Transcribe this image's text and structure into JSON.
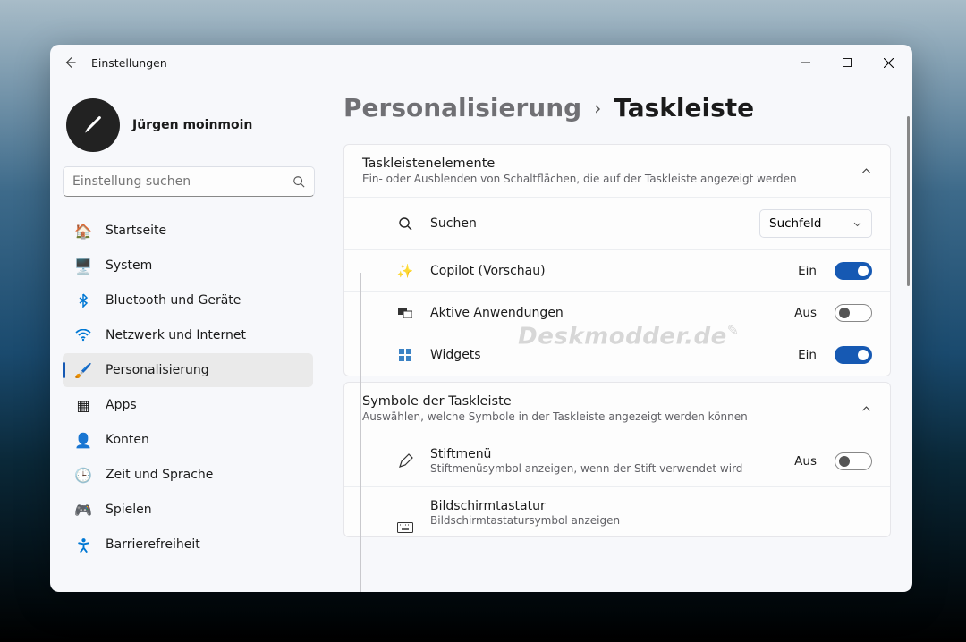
{
  "window": {
    "title": "Einstellungen"
  },
  "user": {
    "name": "Jürgen moinmoin"
  },
  "search": {
    "placeholder": "Einstellung suchen"
  },
  "nav": {
    "items": [
      {
        "label": "Startseite"
      },
      {
        "label": "System"
      },
      {
        "label": "Bluetooth und Geräte"
      },
      {
        "label": "Netzwerk und Internet"
      },
      {
        "label": "Personalisierung"
      },
      {
        "label": "Apps"
      },
      {
        "label": "Konten"
      },
      {
        "label": "Zeit und Sprache"
      },
      {
        "label": "Spielen"
      },
      {
        "label": "Barrierefreiheit"
      }
    ]
  },
  "breadcrumb": {
    "parent": "Personalisierung",
    "current": "Taskleiste"
  },
  "section1": {
    "title": "Taskleistenelemente",
    "subtitle": "Ein- oder Ausblenden von Schaltflächen, die auf der Taskleiste angezeigt werden",
    "rows": {
      "search": {
        "label": "Suchen",
        "dropdown": "Suchfeld"
      },
      "copilot": {
        "label": "Copilot (Vorschau)",
        "state": "Ein"
      },
      "taskview": {
        "label": "Aktive Anwendungen",
        "state": "Aus"
      },
      "widgets": {
        "label": "Widgets",
        "state": "Ein"
      }
    }
  },
  "section2": {
    "title": "Symbole der Taskleiste",
    "subtitle": "Auswählen, welche Symbole in der Taskleiste angezeigt werden können",
    "rows": {
      "pen": {
        "label": "Stiftmenü",
        "sub": "Stiftmenüsymbol anzeigen, wenn der Stift verwendet wird",
        "state": "Aus"
      },
      "touchkb": {
        "label": "Bildschirmtastatur",
        "sub": "Bildschirmtastatursymbol anzeigen"
      }
    }
  },
  "watermark": "Deskmodder.de"
}
